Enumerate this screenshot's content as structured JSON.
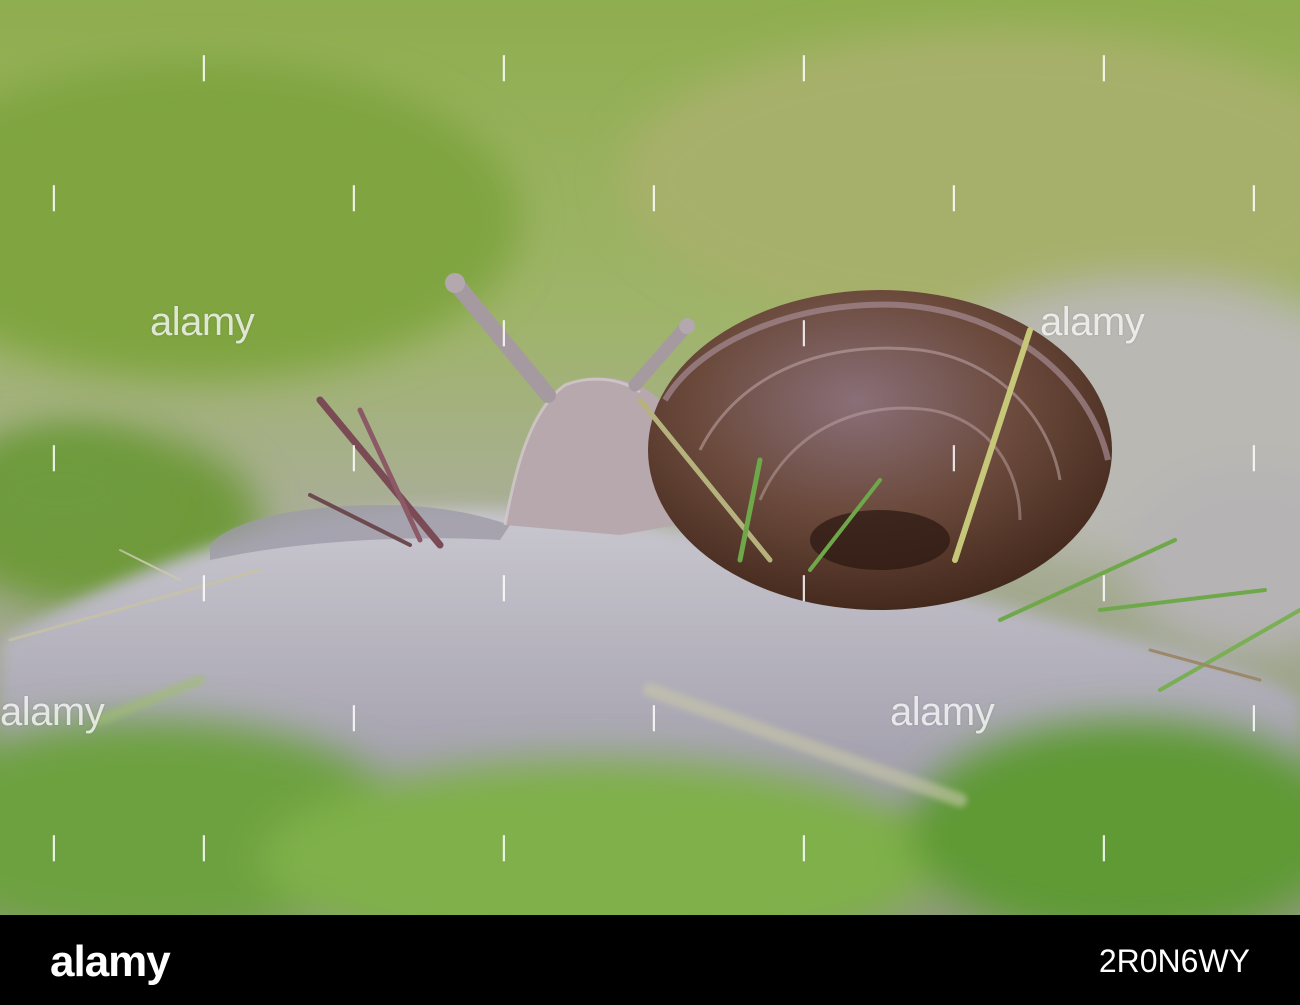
{
  "photo": {
    "subject": "snail on rock"
  },
  "watermark": {
    "text": "alamy"
  },
  "footer": {
    "logo": "alamy",
    "image_id": "2R0N6WY"
  }
}
